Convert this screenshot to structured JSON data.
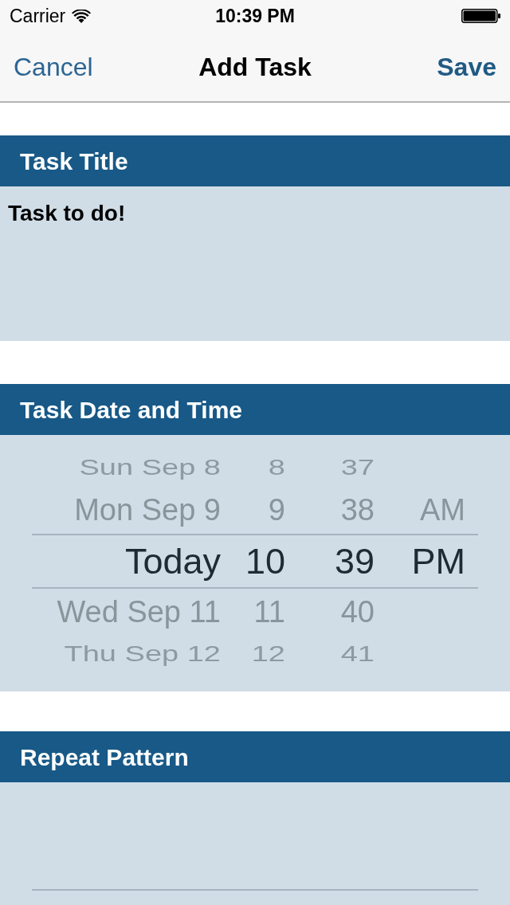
{
  "status_bar": {
    "carrier": "Carrier",
    "time": "10:39 PM"
  },
  "nav_bar": {
    "cancel": "Cancel",
    "title": "Add Task",
    "save": "Save"
  },
  "sections": [
    {
      "kind": "text",
      "header": "Task Title",
      "value": "Task to do!"
    },
    {
      "kind": "picker",
      "header": "Task Date and Time",
      "rows": [
        {
          "date": "Sun Sep 8",
          "hour": "8",
          "minute": "37",
          "selected": false
        },
        {
          "date": "Mon Sep 9",
          "hour": "9",
          "minute": "38",
          "period": "AM",
          "selected": false
        },
        {
          "date": "Today",
          "hour": "10",
          "minute": "39",
          "period": "PM",
          "selected": true
        },
        {
          "date": "Wed Sep 11",
          "hour": "11",
          "minute": "40",
          "selected": false
        },
        {
          "date": "Thu Sep 12",
          "hour": "12",
          "minute": "41",
          "selected": false
        }
      ]
    },
    {
      "kind": "picker",
      "header": "Repeat Pattern"
    }
  ]
}
